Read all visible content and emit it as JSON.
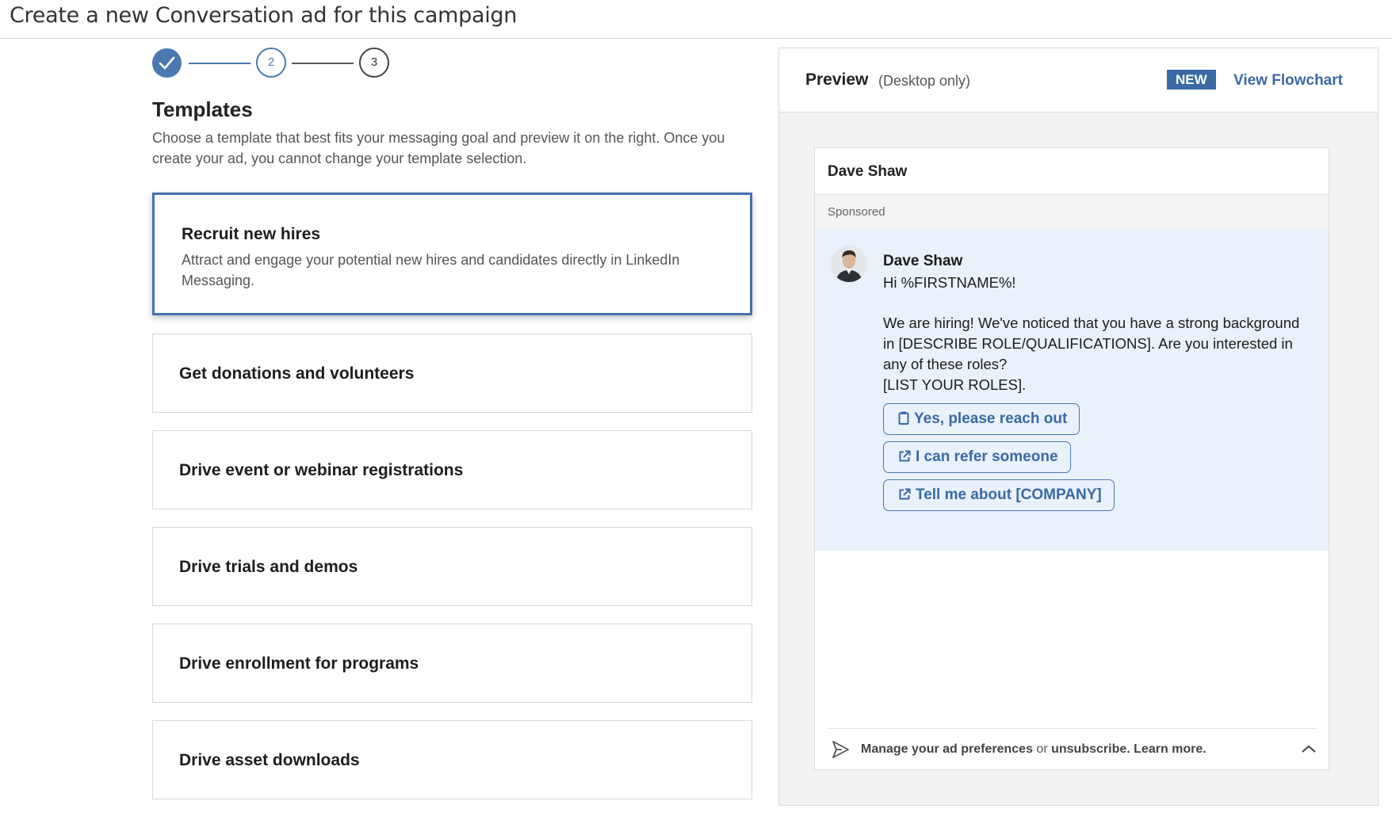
{
  "page": {
    "title": "Create a new Conversation ad for this campaign"
  },
  "stepper": {
    "step2": "2",
    "step3": "3"
  },
  "templates": {
    "title": "Templates",
    "description": "Choose a template that best fits your messaging goal and preview it on the right. Once you create your ad, you cannot change your template selection.",
    "items": [
      {
        "title": "Recruit new hires",
        "description": "Attract and engage your potential new hires and candidates directly in LinkedIn Messaging."
      },
      {
        "title": "Get donations and volunteers"
      },
      {
        "title": "Drive event or webinar registrations"
      },
      {
        "title": "Drive trials and demos"
      },
      {
        "title": "Drive enrollment for programs"
      },
      {
        "title": "Drive asset downloads"
      }
    ]
  },
  "preview": {
    "title": "Preview",
    "subtitle": "(Desktop only)",
    "badge": "NEW",
    "flowchart_link": "View Flowchart",
    "sender_name": "Dave Shaw",
    "sponsored_label": "Sponsored",
    "message": {
      "from": "Dave Shaw",
      "greeting": "Hi %FIRSTNAME%!",
      "body": "We are hiring! We've noticed that you have a strong background in [DESCRIBE ROLE/QUALIFICATIONS]. Are you interested in any of these roles?",
      "roles": "[LIST YOUR ROLES]."
    },
    "cta_buttons": [
      {
        "label": "Yes, please reach out",
        "icon": "clipboard-icon"
      },
      {
        "label": "I can refer someone",
        "icon": "external-link-icon"
      },
      {
        "label": "Tell me about [COMPANY]",
        "icon": "external-link-icon"
      }
    ],
    "footer": {
      "manage": "Manage your ad preferences",
      "or": "or",
      "unsubscribe": "unsubscribe.",
      "learn_more": "Learn more."
    }
  },
  "colors": {
    "accent": "#3a6aa5",
    "message_background": "#e9f1fa"
  }
}
